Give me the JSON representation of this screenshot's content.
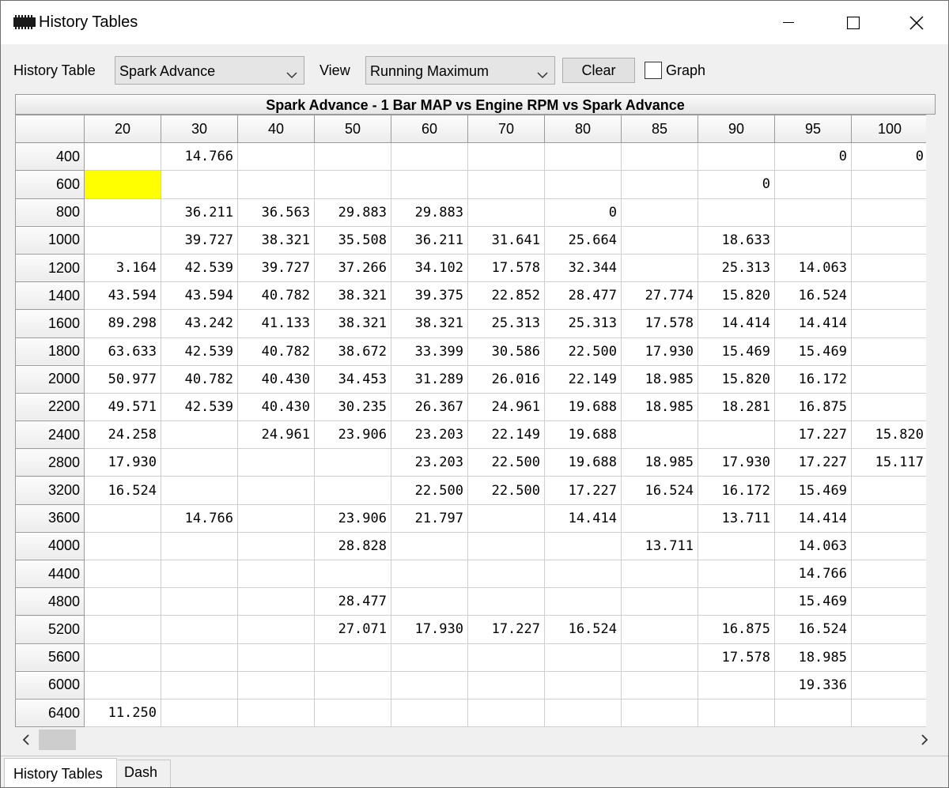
{
  "window": {
    "title": "History Tables",
    "app_icon": "chip-icon"
  },
  "toolbar": {
    "history_table_label": "History Table",
    "history_table_value": "Spark Advance",
    "view_label": "View",
    "view_value": "Running Maximum",
    "clear_label": "Clear",
    "graph_label": "Graph",
    "graph_checked": false
  },
  "table": {
    "title": "Spark Advance - 1 Bar MAP vs Engine RPM vs Spark Advance",
    "columns": [
      "20",
      "30",
      "40",
      "50",
      "60",
      "70",
      "80",
      "85",
      "90",
      "95",
      "100"
    ],
    "rows": [
      {
        "rpm": "400",
        "cells": [
          "",
          "14.766",
          "",
          "",
          "",
          "",
          "",
          "",
          "",
          "0",
          "0"
        ]
      },
      {
        "rpm": "600",
        "cells": [
          "",
          "",
          "",
          "",
          "",
          "",
          "",
          "",
          "0",
          "",
          ""
        ]
      },
      {
        "rpm": "800",
        "cells": [
          "",
          "36.211",
          "36.563",
          "29.883",
          "29.883",
          "",
          "0",
          "",
          "",
          "",
          ""
        ]
      },
      {
        "rpm": "1000",
        "cells": [
          "",
          "39.727",
          "38.321",
          "35.508",
          "36.211",
          "31.641",
          "25.664",
          "",
          "18.633",
          "",
          ""
        ]
      },
      {
        "rpm": "1200",
        "cells": [
          "3.164",
          "42.539",
          "39.727",
          "37.266",
          "34.102",
          "17.578",
          "32.344",
          "",
          "25.313",
          "14.063",
          ""
        ]
      },
      {
        "rpm": "1400",
        "cells": [
          "43.594",
          "43.594",
          "40.782",
          "38.321",
          "39.375",
          "22.852",
          "28.477",
          "27.774",
          "15.820",
          "16.524",
          ""
        ]
      },
      {
        "rpm": "1600",
        "cells": [
          "89.298",
          "43.242",
          "41.133",
          "38.321",
          "38.321",
          "25.313",
          "25.313",
          "17.578",
          "14.414",
          "14.414",
          ""
        ]
      },
      {
        "rpm": "1800",
        "cells": [
          "63.633",
          "42.539",
          "40.782",
          "38.672",
          "33.399",
          "30.586",
          "22.500",
          "17.930",
          "15.469",
          "15.469",
          ""
        ]
      },
      {
        "rpm": "2000",
        "cells": [
          "50.977",
          "40.782",
          "40.430",
          "34.453",
          "31.289",
          "26.016",
          "22.149",
          "18.985",
          "15.820",
          "16.172",
          ""
        ]
      },
      {
        "rpm": "2200",
        "cells": [
          "49.571",
          "42.539",
          "40.430",
          "30.235",
          "26.367",
          "24.961",
          "19.688",
          "18.985",
          "18.281",
          "16.875",
          ""
        ]
      },
      {
        "rpm": "2400",
        "cells": [
          "24.258",
          "",
          "24.961",
          "23.906",
          "23.203",
          "22.149",
          "19.688",
          "",
          "",
          "17.227",
          "15.820"
        ]
      },
      {
        "rpm": "2800",
        "cells": [
          "17.930",
          "",
          "",
          "",
          "23.203",
          "22.500",
          "19.688",
          "18.985",
          "17.930",
          "17.227",
          "15.117"
        ]
      },
      {
        "rpm": "3200",
        "cells": [
          "16.524",
          "",
          "",
          "",
          "22.500",
          "22.500",
          "17.227",
          "16.524",
          "16.172",
          "15.469",
          ""
        ]
      },
      {
        "rpm": "3600",
        "cells": [
          "",
          "14.766",
          "",
          "23.906",
          "21.797",
          "",
          "14.414",
          "",
          "13.711",
          "14.414",
          ""
        ]
      },
      {
        "rpm": "4000",
        "cells": [
          "",
          "",
          "",
          "28.828",
          "",
          "",
          "",
          "13.711",
          "",
          "14.063",
          ""
        ]
      },
      {
        "rpm": "4400",
        "cells": [
          "",
          "",
          "",
          "",
          "",
          "",
          "",
          "",
          "",
          "14.766",
          ""
        ]
      },
      {
        "rpm": "4800",
        "cells": [
          "",
          "",
          "",
          "28.477",
          "",
          "",
          "",
          "",
          "",
          "15.469",
          ""
        ]
      },
      {
        "rpm": "5200",
        "cells": [
          "",
          "",
          "",
          "27.071",
          "17.930",
          "17.227",
          "16.524",
          "",
          "16.875",
          "16.524",
          ""
        ]
      },
      {
        "rpm": "5600",
        "cells": [
          "",
          "",
          "",
          "",
          "",
          "",
          "",
          "",
          "17.578",
          "18.985",
          ""
        ]
      },
      {
        "rpm": "6000",
        "cells": [
          "",
          "",
          "",
          "",
          "",
          "",
          "",
          "",
          "",
          "19.336",
          ""
        ]
      },
      {
        "rpm": "6400",
        "cells": [
          "11.250",
          "",
          "",
          "",
          "",
          "",
          "",
          "",
          "",
          "",
          ""
        ]
      }
    ],
    "highlight_color": "#ffff00"
  },
  "tabs": [
    {
      "label": "History Tables",
      "active": true
    },
    {
      "label": "Dash",
      "active": false
    }
  ]
}
